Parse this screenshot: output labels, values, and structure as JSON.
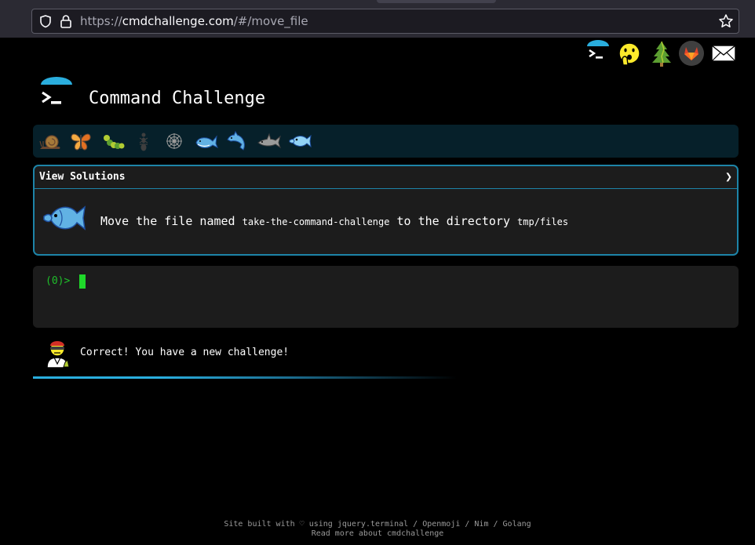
{
  "browser": {
    "url_scheme": "https://",
    "url_host": "cmdchallenge.com",
    "url_path": "/#/move_file"
  },
  "header": {
    "title": "Command Challenge"
  },
  "top_icons": [
    "terminal-logo-icon",
    "shushing-face-icon",
    "tree-icon",
    "gitlab-icon",
    "envelope-icon"
  ],
  "challenge_strip": [
    "snail-icon",
    "butterfly-icon",
    "caterpillar-icon",
    "ant-icon",
    "spider-web-icon",
    "whale-icon",
    "dolphin-icon",
    "shark-icon",
    "fish-icon"
  ],
  "panel": {
    "header_label": "View Solutions",
    "chevron": "❯",
    "desc_1": "Move the file named ",
    "desc_file": "take-the-command-challenge",
    "desc_2": " to the directory ",
    "desc_dir": "tmp/files"
  },
  "terminal": {
    "prompt": "(0)>"
  },
  "result": {
    "message": "Correct! You have a new challenge!",
    "progress": 0.3
  },
  "footer": {
    "line1": "Site built with ♡ using jquery.terminal / Openmoji / Nim / Golang",
    "line2": "Read more about cmdchallenge"
  },
  "colors": {
    "accent": "#1d84a8",
    "prompt_green": "#1fbf2a",
    "strip_bg": "#06202a"
  }
}
